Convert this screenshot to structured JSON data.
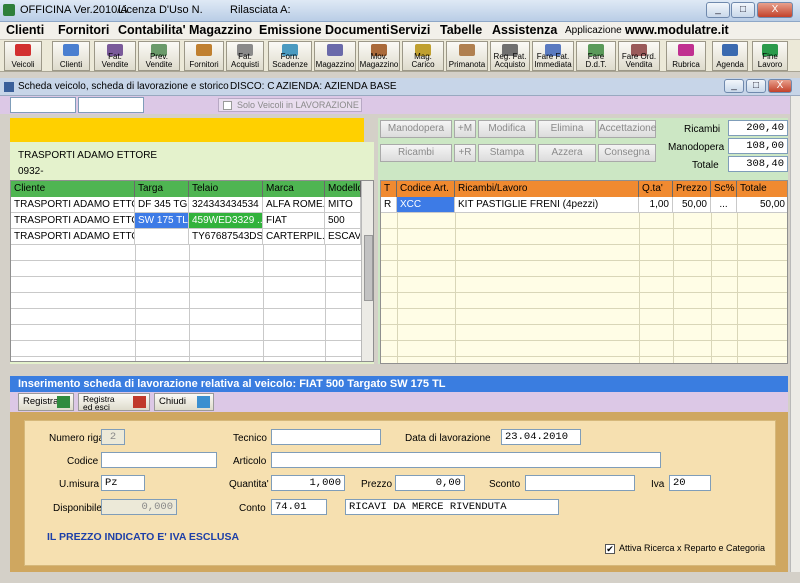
{
  "titlebar": {
    "app_title": "OFFICINA Ver.2010/A",
    "license": "Licenza D'Uso N.",
    "issued": "Rilasciata A:",
    "min": "_",
    "max": "□",
    "close": "X"
  },
  "menu": {
    "items": [
      "Clienti",
      "Fornitori",
      "Contabilita'",
      "Magazzino",
      "Emissione Documenti",
      "Servizi",
      "Tabelle",
      "Assistenza"
    ],
    "app_label": "Applicazione",
    "website": "www.modulatre.it"
  },
  "toolbar": {
    "buttons": [
      {
        "label": "Veicoli",
        "color": "#d23030"
      },
      {
        "label": "Clienti",
        "color": "#4a7fd0"
      },
      {
        "label": "Fat. Vendite",
        "color": "#7a5a9a"
      },
      {
        "label": "Prev. Vendite",
        "color": "#6a9a6a"
      },
      {
        "label": "Fornitori",
        "color": "#c08030"
      },
      {
        "label": "Fat. Acquisti",
        "color": "#8a8a8a"
      },
      {
        "label": "Forn. Scadenze",
        "color": "#4a9ac0"
      },
      {
        "label": "Magazzino",
        "color": "#6a6aaa"
      },
      {
        "label": "Mov. Magazzino",
        "color": "#aa6a3a"
      },
      {
        "label": "Mag. Carico",
        "color": "#c0a030"
      },
      {
        "label": "Primanota",
        "color": "#b08050"
      },
      {
        "label": "Reg. Fat. Acquisto",
        "color": "#707070"
      },
      {
        "label": "Fare Fat. Immediata",
        "color": "#5a7ac0"
      },
      {
        "label": "Fare D.d.T.",
        "color": "#5a9a5a"
      },
      {
        "label": "Fare Ord. Vendita",
        "color": "#9a5a5a"
      },
      {
        "label": "Rubrica",
        "color": "#c03090"
      },
      {
        "label": "Agenda",
        "color": "#3a6ab0"
      },
      {
        "label": "Fine Lavoro",
        "color": "#2a9a4a"
      }
    ]
  },
  "info": {
    "title": "Scheda veicolo, scheda di lavorazione e storico",
    "disk": "DISCO: C",
    "company": "AZIENDA: AZIENDA BASE"
  },
  "filter": {
    "field1": "",
    "field2": "",
    "checkbox_label": "Solo Veicoli in LAVORAZIONE"
  },
  "customer": {
    "name": "TRASPORTI ADAMO ETTORE",
    "code": "0932-"
  },
  "right_buttons": {
    "manodopera": "Manodopera",
    "plus_m": "+M",
    "modifica": "Modifica",
    "elimina": "Elimina",
    "accettazione": "Accettazione",
    "ricambi": "Ricambi",
    "plus_r": "+R",
    "stampa": "Stampa",
    "azzera": "Azzera",
    "consegna": "Consegna"
  },
  "totals": {
    "ricambi_label": "Ricambi",
    "ricambi": "200,40",
    "manodopera_label": "Manodopera",
    "manodopera": "108,00",
    "totale_label": "Totale",
    "totale": "308,40"
  },
  "vehicles": {
    "columns": [
      "Cliente",
      "Targa",
      "Telaio",
      "Marca",
      "Modello"
    ],
    "rows": [
      [
        "TRASPORTI ADAMO ETTO...",
        "DF 345 TG",
        "324343434534 ...",
        "ALFA ROME...",
        "MITO"
      ],
      [
        "TRASPORTI ADAMO ETTO...",
        "SW 175 TL",
        "459WED3329 ...",
        "FIAT",
        "500"
      ],
      [
        "TRASPORTI ADAMO ETTO...",
        "",
        "TY67687543DS...",
        "CARTERPIL...",
        "ESCAVA"
      ]
    ]
  },
  "parts": {
    "columns": [
      "T",
      "Codice Art.",
      "Ricambi/Lavoro",
      "Q.ta'",
      "Prezzo",
      "Sc%",
      "Totale"
    ],
    "rows": [
      [
        "R",
        "XCC",
        "KIT PASTIGLIE FRENI (4pezzi)",
        "1,00",
        "50,00",
        "...",
        "50,00"
      ]
    ]
  },
  "workbar": {
    "text": "Inserimento scheda di lavorazione relativa al veicolo: FIAT  500  Targato SW 175 TL"
  },
  "actions": {
    "registra": "Registra",
    "registra_esci": "Registra ed esci",
    "chiudi": "Chiudi"
  },
  "form": {
    "numero_riga_label": "Numero riga",
    "numero_riga": "2",
    "tecnico_label": "Tecnico",
    "tecnico": "",
    "data_label": "Data di lavorazione",
    "data": "23.04.2010",
    "codice_label": "Codice",
    "codice": "",
    "articolo_label": "Articolo",
    "articolo": "",
    "umisura_label": "U.misura",
    "umisura": "Pz",
    "quantita_label": "Quantita'",
    "quantita": "1,000",
    "prezzo_label": "Prezzo",
    "prezzo": "0,00",
    "sconto_label": "Sconto",
    "sconto": "",
    "iva_label": "Iva",
    "iva": "20",
    "disponibile_label": "Disponibile",
    "disponibile": "0,000",
    "conto_label": "Conto",
    "conto": "74.01",
    "conto_desc": "RICAVI DA MERCE RIVENDUTA",
    "note": "IL PREZZO INDICATO E' IVA ESCLUSA",
    "checkbox_label": "Attiva Ricerca x Reparto e Categoria"
  }
}
